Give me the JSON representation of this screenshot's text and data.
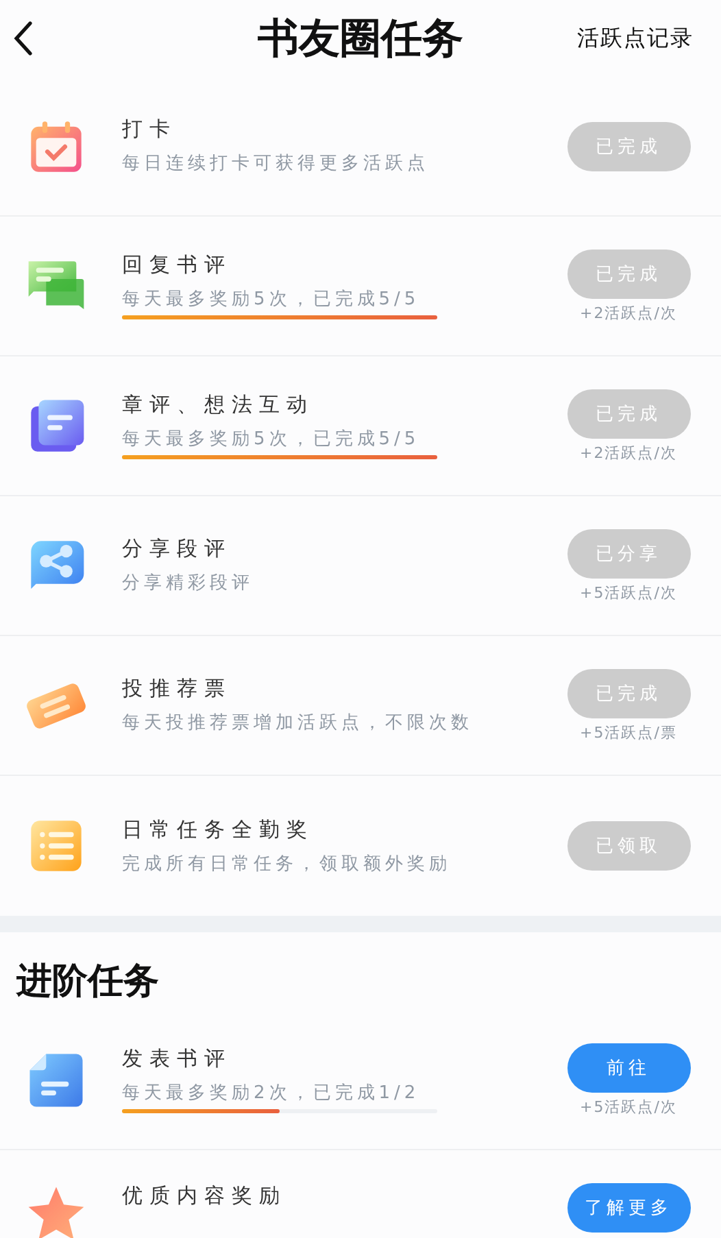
{
  "header": {
    "title": "书友圈任务",
    "record_link": "活跃点记录"
  },
  "daily_tasks": [
    {
      "kind": "calendar",
      "title": "打卡",
      "desc": "每日连续打卡可获得更多活跃点",
      "button": {
        "label": "已完成",
        "kind": "done"
      }
    },
    {
      "kind": "chat",
      "title": "回复书评",
      "desc": "每天最多奖励5次，已完成5/5",
      "level": 1,
      "button": {
        "label": "已完成",
        "kind": "done"
      },
      "reward": "+2活跃点/次"
    },
    {
      "kind": "notes",
      "title": "章评、想法互动",
      "desc": "每天最多奖励5次，已完成5/5",
      "level": 1,
      "button": {
        "label": "已完成",
        "kind": "done"
      },
      "reward": "+2活跃点/次"
    },
    {
      "kind": "share",
      "title": "分享段评",
      "desc": "分享精彩段评",
      "button": {
        "label": "已分享",
        "kind": "done"
      },
      "reward": "+5活跃点/次"
    },
    {
      "kind": "ticket",
      "title": "投推荐票",
      "desc": "每天投推荐票增加活跃点，不限次数",
      "button": {
        "label": "已完成",
        "kind": "done"
      },
      "reward": "+5活跃点/票"
    },
    {
      "kind": "list",
      "title": "日常任务全勤奖",
      "desc": "完成所有日常任务，领取额外奖励",
      "button": {
        "label": "已领取",
        "kind": "done"
      }
    }
  ],
  "advanced_section": {
    "title": "进阶任务",
    "tasks": [
      {
        "kind": "document",
        "title": "发表书评",
        "desc": "每天最多奖励2次，已完成1/2",
        "level": 0.5,
        "button": {
          "label": "前往",
          "kind": "go"
        },
        "reward": "+5活跃点/次"
      },
      {
        "kind": "star",
        "title": "优质内容奖励",
        "button": {
          "label": "了解更多",
          "kind": "go"
        }
      }
    ]
  }
}
